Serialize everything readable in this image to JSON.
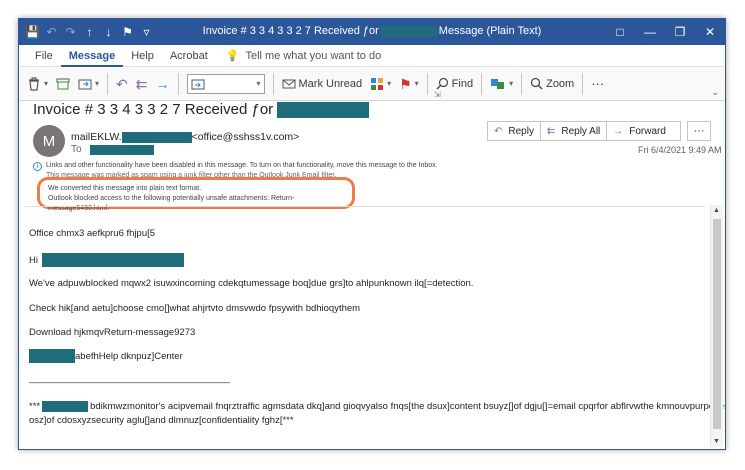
{
  "window": {
    "title_prefix": "Invoice # 3 3 4 3 3 2 7 Received ƒor",
    "title_suffix": "Message (Plain Text)"
  },
  "qat": {
    "save": "💾",
    "undo": "↶",
    "redo": "↷",
    "up": "↑",
    "down": "↓",
    "tag": "⚑",
    "dropdown": "▿"
  },
  "controls": {
    "ribbon_options": "□",
    "minimize": "—",
    "restore": "❐",
    "close": "✕"
  },
  "menu": {
    "tabs": [
      "File",
      "Message",
      "Help",
      "Acrobat"
    ],
    "active": "Message",
    "tell_me": "Tell me what you want to do",
    "tell_me_icon": "💡"
  },
  "ribbon": {
    "mark_unread": "Mark Unread",
    "find": "Find",
    "zoom": "Zoom",
    "more": "···"
  },
  "message": {
    "subject": "Invoice # 3 3 4 3 3 2 7 Received ƒor",
    "avatar_initial": "M",
    "from_name": "mailEKLW.",
    "from_email": "<office@sshss1v.com>",
    "to_label": "To",
    "date": "Fri 6/4/2021 9:49 AM"
  },
  "actions": {
    "reply": "Reply",
    "reply_all": "Reply All",
    "forward": "Forward",
    "more": "···"
  },
  "notices": {
    "line1": "Links and other functionality have been disabled in this message. To turn on that functionality, move this message to the Inbox.",
    "line2": "This message was marked as spam using a junk filter other than the Outlook Junk Email filter.",
    "plain_text": "We converted this message into plain text format.",
    "blocked": "Outlook blocked access to the following potentially unsafe attachments: Return-message5490.html."
  },
  "body": {
    "line1": "Office chmx3 aefkpru6 fhjpu[5",
    "hi": "Hi",
    "line3": "We've adpuwblocked mqwx2 isuwxincoming cdekqtumessage boq]due grs]to ahlpunknown ilq[=detection.",
    "line4": "Check hik[and aetu]choose cmo[]what ahjrtvto dmsvwdo fpsywith bdhioqythem",
    "line5": "Download hjkmqvReturn-message9273",
    "line6": "abefhHelp dknpuz]Center",
    "rule": "______________________________________",
    "footer_start": "***",
    "footer_rest": "bdikmwzmonitor's acipvemail fnqrztraffic agmsdata dkq]and gioqvyalso fnqs[the dsux]content bsuyz[]of dgju[]=email cpqrfor abflrvwthe kmnouvpurposes",
    "footer_line2": "osz]of cdosxyzsecurity aglu[]and dlmnuz[confidentiality fghz[***"
  },
  "colors": {
    "title_bar": "#2b579a",
    "redaction": "#1f6d7a",
    "highlight_border": "#f07b4a"
  }
}
